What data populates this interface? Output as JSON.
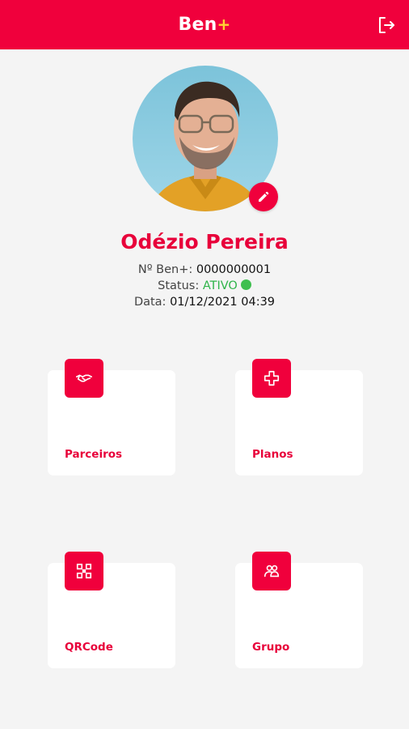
{
  "header": {
    "logo_text": "Ben",
    "logo_plus": "+",
    "logout_icon": "logout-icon"
  },
  "profile": {
    "name": "Odézio Pereira",
    "number_label": "Nº Ben+:",
    "number_value": "0000000001",
    "status_label": "Status:",
    "status_value": "ATIVO",
    "status_color": "#3fbf4f",
    "date_label": "Data:",
    "date_value": "01/12/2021 04:39"
  },
  "menu": [
    {
      "label": "Parceiros",
      "icon": "handshake-icon"
    },
    {
      "label": "Planos",
      "icon": "plus-icon"
    },
    {
      "label": "QRCode",
      "icon": "qrcode-icon"
    },
    {
      "label": "Grupo",
      "icon": "group-icon"
    }
  ],
  "colors": {
    "brand": "#f0003c",
    "background": "#f4f4f4",
    "card": "#ffffff"
  }
}
